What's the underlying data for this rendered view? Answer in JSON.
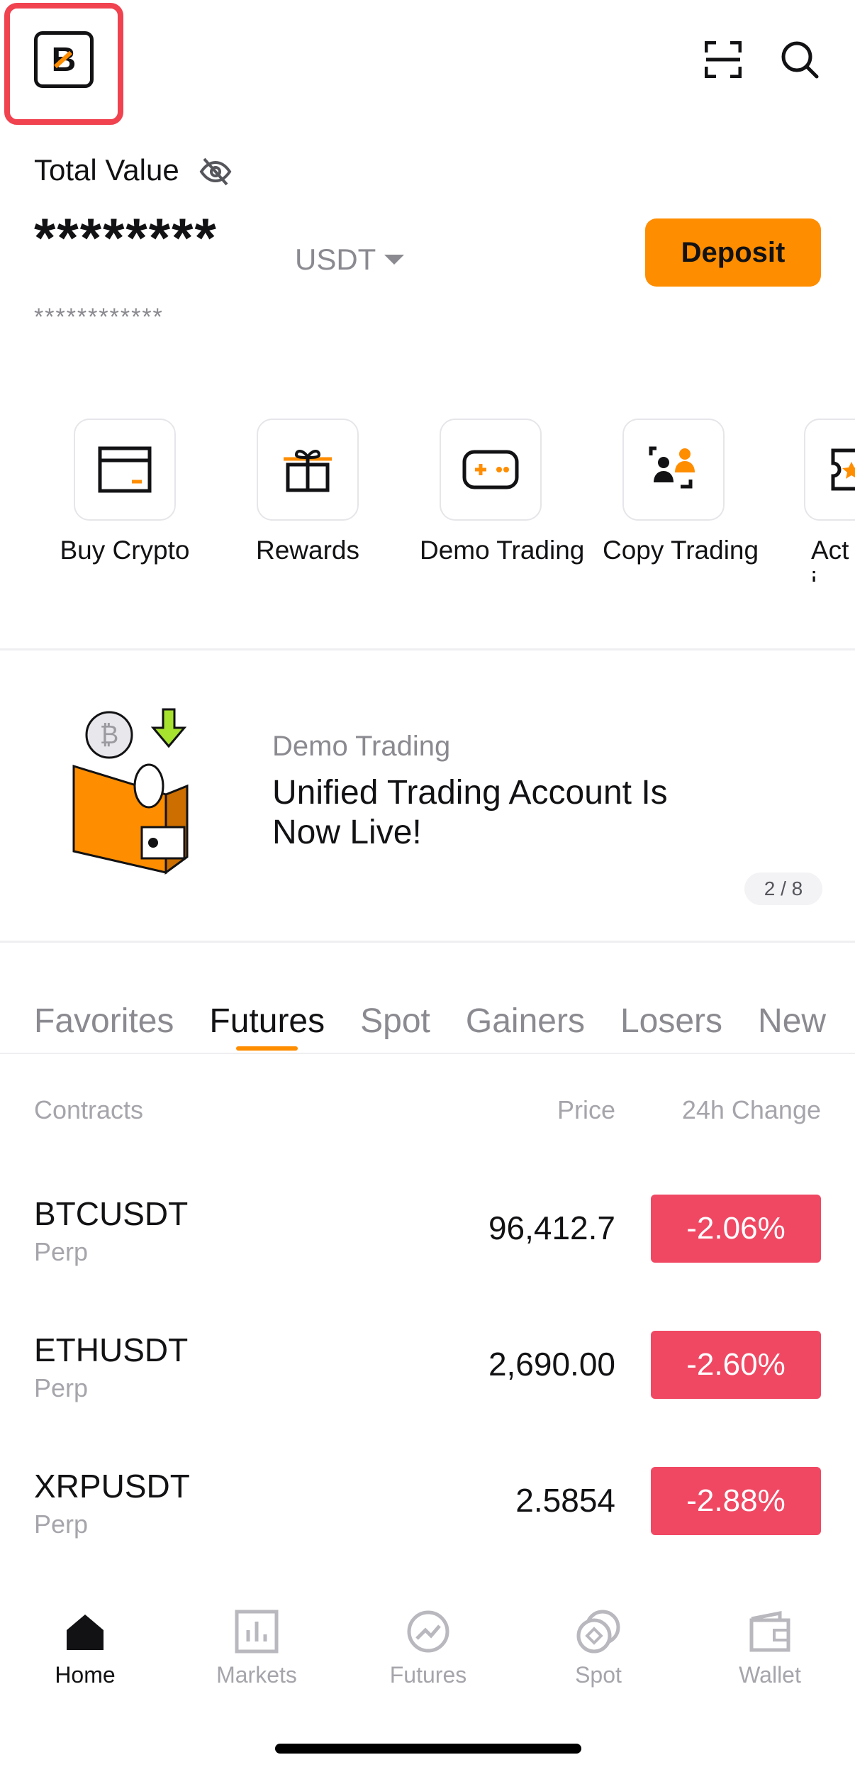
{
  "header": {
    "logo_letter": "B",
    "total_label": "Total Value",
    "masked_balance": "********",
    "currency": "USDT",
    "masked_sub": "************",
    "deposit_label": "Deposit"
  },
  "quick_actions": [
    {
      "label": "Buy Crypto",
      "icon": "card-icon"
    },
    {
      "label": "Rewards",
      "icon": "gift-icon"
    },
    {
      "label": "Demo Trading",
      "icon": "gamepad-icon"
    },
    {
      "label": "Copy Trading",
      "icon": "people-icon"
    },
    {
      "label": "Acti Cer",
      "icon": "ticket-icon"
    }
  ],
  "banner": {
    "subtitle": "Demo Trading",
    "title": "Unified Trading Account Is Now Live!",
    "pager": "2 / 8"
  },
  "tabs": [
    "Favorites",
    "Futures",
    "Spot",
    "Gainers",
    "Losers",
    "New"
  ],
  "active_tab": "Futures",
  "table": {
    "col_contracts": "Contracts",
    "col_price": "Price",
    "col_change": "24h Change",
    "rows": [
      {
        "symbol": "BTCUSDT",
        "type": "Perp",
        "price": "96,412.7",
        "change": "-2.06%"
      },
      {
        "symbol": "ETHUSDT",
        "type": "Perp",
        "price": "2,690.00",
        "change": "-2.60%"
      },
      {
        "symbol": "XRPUSDT",
        "type": "Perp",
        "price": "2.5854",
        "change": "-2.88%"
      }
    ]
  },
  "nav": [
    {
      "label": "Home",
      "icon": "home-icon"
    },
    {
      "label": "Markets",
      "icon": "bar-chart-icon"
    },
    {
      "label": "Futures",
      "icon": "futures-icon"
    },
    {
      "label": "Spot",
      "icon": "coins-icon"
    },
    {
      "label": "Wallet",
      "icon": "wallet-icon"
    }
  ],
  "colors": {
    "accent": "#ff8d00",
    "negative": "#f04863",
    "highlight_frame": "#f0424f"
  }
}
